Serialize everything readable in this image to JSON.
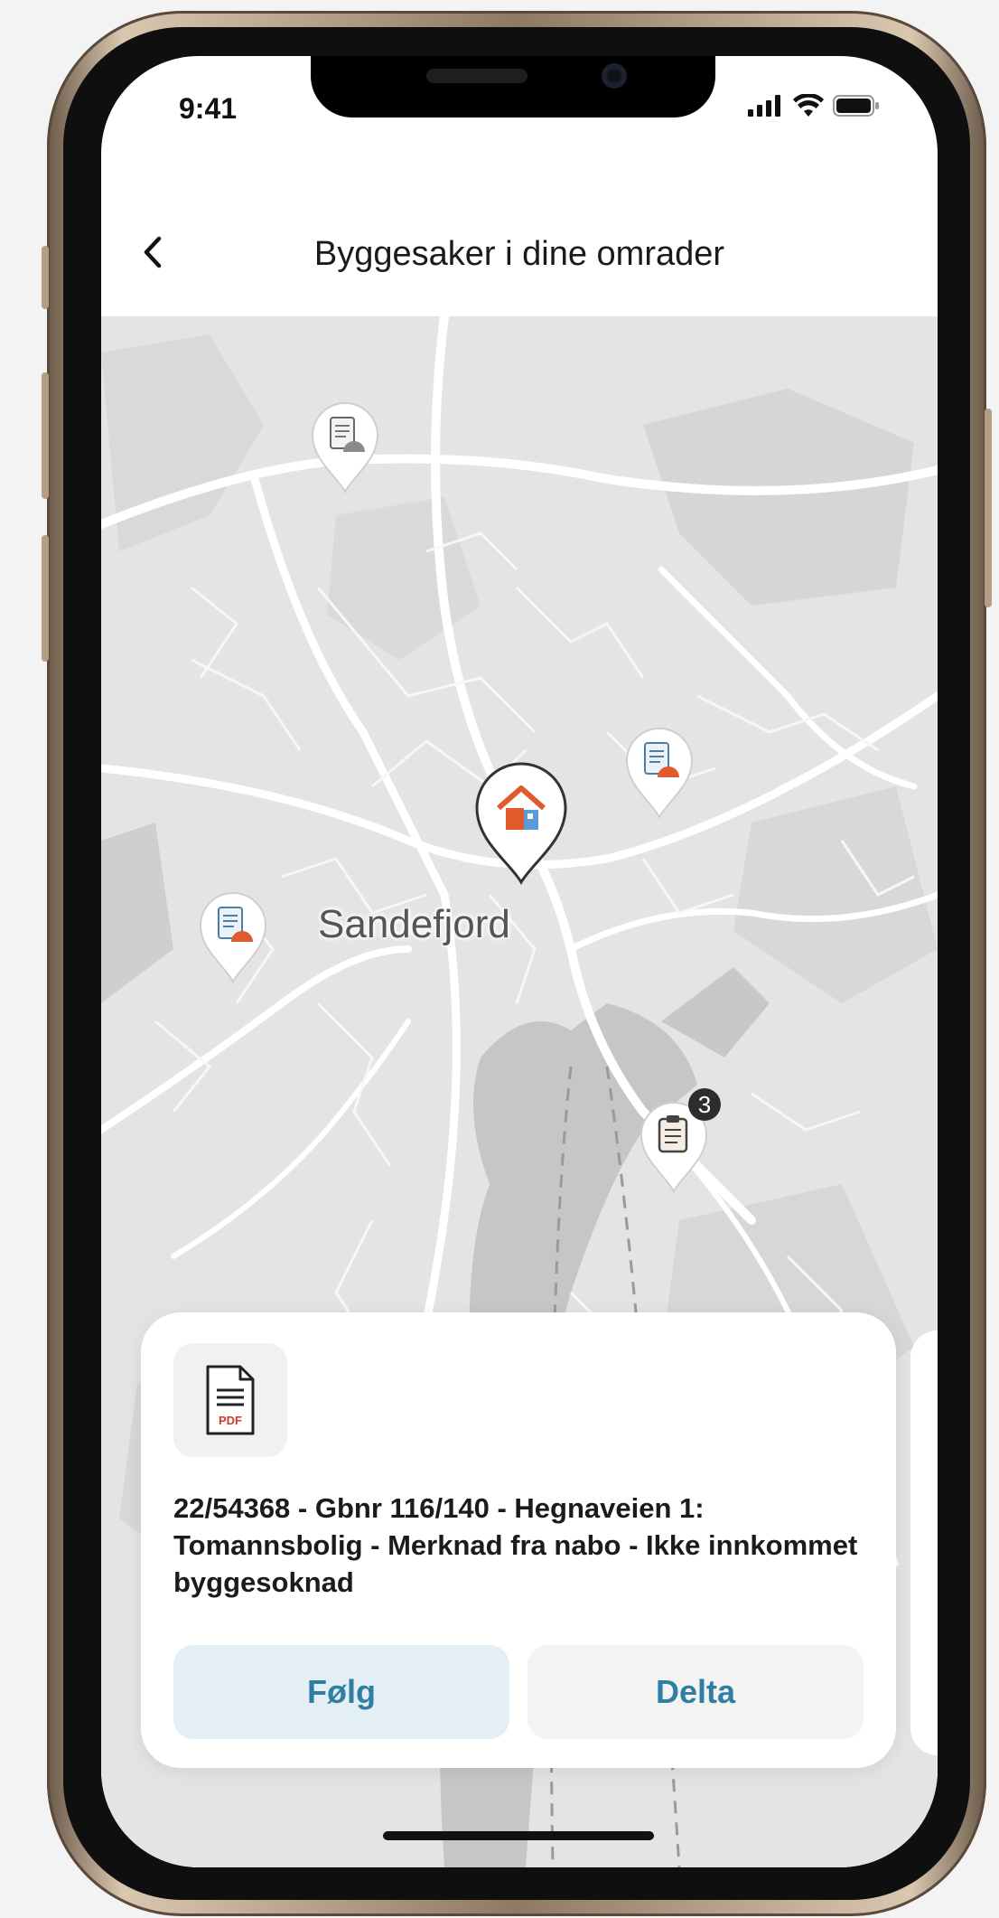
{
  "status": {
    "time": "9:41",
    "icons": [
      "signal-icon",
      "wifi-icon",
      "battery-icon"
    ]
  },
  "header": {
    "title": "Byggesaker i dine omrader",
    "back_icon": "chevron-left-icon"
  },
  "map": {
    "city": "Sandefjord",
    "pins": [
      {
        "icon": "document-notice-icon"
      },
      {
        "icon": "document-notice-icon"
      },
      {
        "icon": "house-icon"
      },
      {
        "icon": "document-notice-icon"
      },
      {
        "icon": "clipboard-list-icon",
        "badge": "3"
      }
    ]
  },
  "card": {
    "icon": "pdf-document-icon",
    "icon_label": "PDF",
    "description": "22/54368 - Gbnr 116/140 - Hegnaveien 1: Tomannsbolig - Merknad fra nabo - Ikke innkommet byggesoknad",
    "follow_label": "Følg",
    "join_label": "Delta"
  },
  "colors": {
    "accent": "#2f7fa3",
    "house_roof": "#e05a2b",
    "follow_bg": "#e3eff4"
  }
}
